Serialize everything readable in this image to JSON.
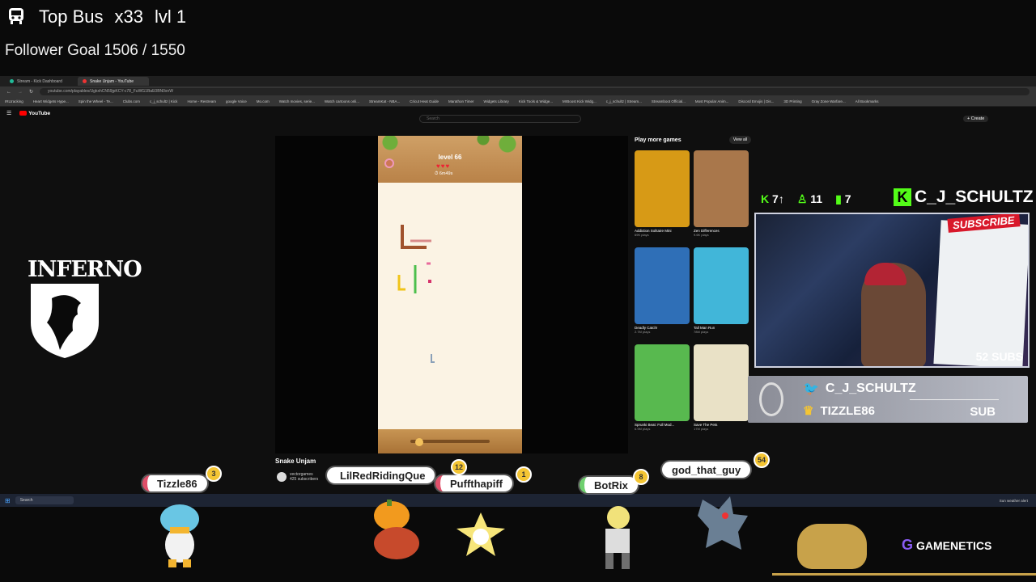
{
  "overlay": {
    "bus_title": "Top Bus",
    "bus_multiplier": "x33",
    "bus_level": "lvl 1",
    "follower_goal": "Follower Goal 1506 / 1550",
    "logo_text": "INFERNO"
  },
  "browser": {
    "tabs": [
      {
        "label": "Stream - Kick Dashboard"
      },
      {
        "label": "Snake Unjam - YouTube"
      }
    ],
    "url": "youtube.com/playables/UgkxhCN59jpKCY-c78_FuWG1BaE0BN0xnW",
    "bookmarks": [
      "IRLtracking",
      "Heart Widgets Hype...",
      "Spin the Wheel - Te...",
      "Clubs.com",
      "c_j_schultz | Kick",
      "Home - Restream",
      "google Voice",
      "Mo.com",
      "Watch movies, serie...",
      "Watch cartoons onli...",
      "StreamKat - NBA...",
      "Cricut Heat Guide",
      "Marathon Timer",
      "Widgets Library",
      "Kick Tools & Widge...",
      "MrBoost Kick Widg...",
      "c_j_schultz | Stream...",
      "Streamboot Official...",
      "Most Popular Anim...",
      "Discord Emojis | Dis...",
      "3D Printing",
      "Gray Zone Warfare...",
      "All Bookmarks"
    ],
    "search_placeholder": "Search",
    "create_label": "+ Create",
    "yt_label": "YouTube"
  },
  "game": {
    "level": "level 66",
    "hearts": "♥♥♥",
    "timer": "⏱ 6m49s"
  },
  "video": {
    "title": "Snake Unjam",
    "channel": "vectorgames",
    "subscribers": "425 subscribers"
  },
  "games_panel": {
    "header": "Play more games",
    "view_all": "View all",
    "items": [
      {
        "title": "Addiction Solitaire Mini",
        "plays": "69K plays",
        "color": "#d79a16"
      },
      {
        "title": "Zen Differences",
        "plays": "9.6K plays",
        "color": "#a9774b"
      },
      {
        "title": "Deadly Catch!",
        "plays": "2.7M plays",
        "color": "#2f6fb7"
      },
      {
        "title": "Tall Man Run",
        "plays": "78M plays",
        "color": "#41b6d9"
      },
      {
        "title": "Sprunki Beat: Full Mod...",
        "plays": "6.9M plays",
        "color": "#58b94f"
      },
      {
        "title": "Save The Pets",
        "plays": "17M plays",
        "color": "#e9e1c6"
      }
    ]
  },
  "stats": {
    "kicks": "7",
    "follows": "11",
    "viewers": "7"
  },
  "streamer": {
    "kick_name": "C_J_SCHULTZ",
    "subscribe_badge": "SUBSCRIBE",
    "subs": "52 SUBS",
    "twitter": "C_J_SCHULTZ",
    "last_sub": "TIZZLE86",
    "sub_label": "SUB"
  },
  "chatters": [
    {
      "name": "Tizzle86",
      "badge": "3"
    },
    {
      "name": "LilRedRidingQue",
      "badge": "12"
    },
    {
      "name": "Puffthapiff",
      "badge": "1"
    },
    {
      "name": "BotRix",
      "badge": "8"
    },
    {
      "name": "god_that_guy",
      "badge": "54"
    }
  ],
  "taskbar": {
    "search": "Search",
    "tray": "Sun weather alert"
  },
  "brand": {
    "name": "GAMENETICS"
  },
  "colors": {
    "kick_green": "#53fc18",
    "yt_red": "#ff0000",
    "gold": "#c8a24a"
  }
}
